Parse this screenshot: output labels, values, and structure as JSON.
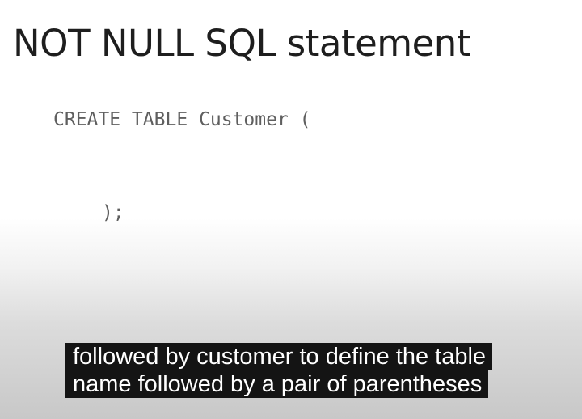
{
  "slide": {
    "title": "NOT NULL SQL statement",
    "code_lines": [
      "CREATE TABLE Customer (",
      ");"
    ]
  },
  "captions": {
    "lines": [
      "followed by customer to define the table",
      "name followed by a pair of parentheses"
    ]
  }
}
